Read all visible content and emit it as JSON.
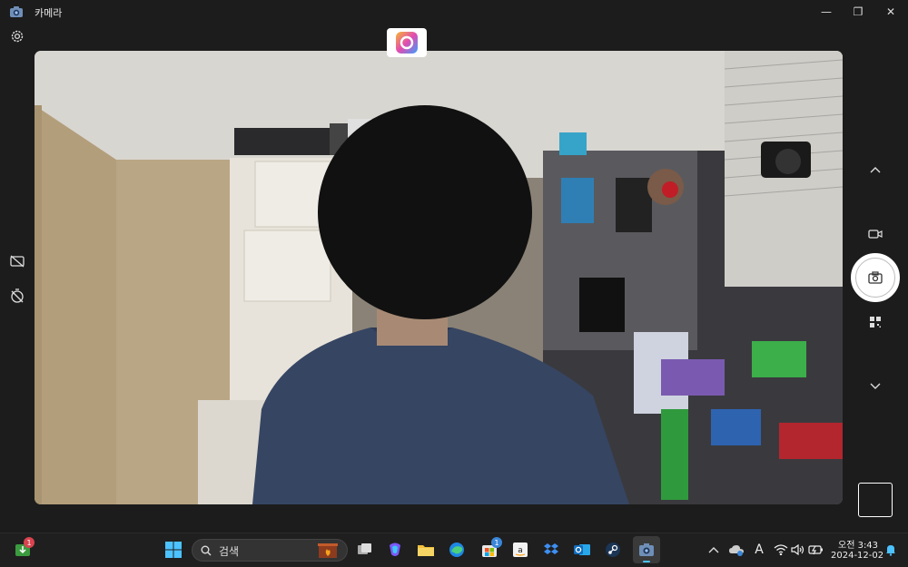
{
  "window": {
    "title": "카메라"
  },
  "window_controls": {
    "minimize": "—",
    "maximize": "❐",
    "close": "✕"
  },
  "taskbar": {
    "search_placeholder": "검색",
    "widgets_badge": "1",
    "store_badge": "1",
    "clock_time": "오전 3:43",
    "clock_date": "2024-12-02",
    "ime_label": "A"
  },
  "colors": {
    "shutter": "#ffffff",
    "taskbar_bg": "#1f1f1f",
    "window_bg": "#1c1c1c"
  }
}
